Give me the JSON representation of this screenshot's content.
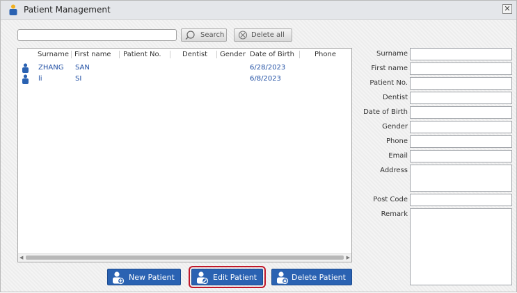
{
  "window": {
    "title": "Patient Management",
    "close_glyph": "✕"
  },
  "toolbar": {
    "search_value": "",
    "search_label": "Search",
    "delete_all_label": "Delete all"
  },
  "list": {
    "columns": [
      "Surname",
      "First name",
      "Patient No.",
      "Dentist",
      "Gender",
      "Date of Birth",
      "Phone"
    ],
    "rows": [
      {
        "surname": "ZHANG",
        "first_name": "SAN",
        "patient_no": "",
        "dentist": "",
        "gender": "",
        "dob": "6/28/2023",
        "phone": ""
      },
      {
        "surname": "li",
        "first_name": "SI",
        "patient_no": "",
        "dentist": "",
        "gender": "",
        "dob": "6/8/2023",
        "phone": ""
      }
    ]
  },
  "form": {
    "labels": {
      "surname": "Surname",
      "first_name": "First name",
      "patient_no": "Patient No.",
      "dentist": "Dentist",
      "dob": "Date of Birth",
      "gender": "Gender",
      "phone": "Phone",
      "email": "Email",
      "address": "Address",
      "post_code": "Post Code",
      "remark": "Remark"
    },
    "values": {
      "surname": "",
      "first_name": "",
      "patient_no": "",
      "dentist": "",
      "dob": "",
      "gender": "",
      "phone": "",
      "email": "",
      "address": "",
      "post_code": "",
      "remark": ""
    }
  },
  "actions": {
    "new_patient": "New Patient",
    "edit_patient": "Edit Patient",
    "delete_patient": "Delete Patient"
  },
  "colors": {
    "accent": "#2a62b2",
    "list_text": "#1f4ea3",
    "highlight": "#c0182a"
  },
  "icons": {
    "title": "patient-icon",
    "search": "search-icon",
    "delete_all": "delete-all-icon",
    "row": "patient-icon",
    "new": "new-patient-icon",
    "edit": "edit-patient-icon",
    "delete": "delete-patient-icon"
  }
}
